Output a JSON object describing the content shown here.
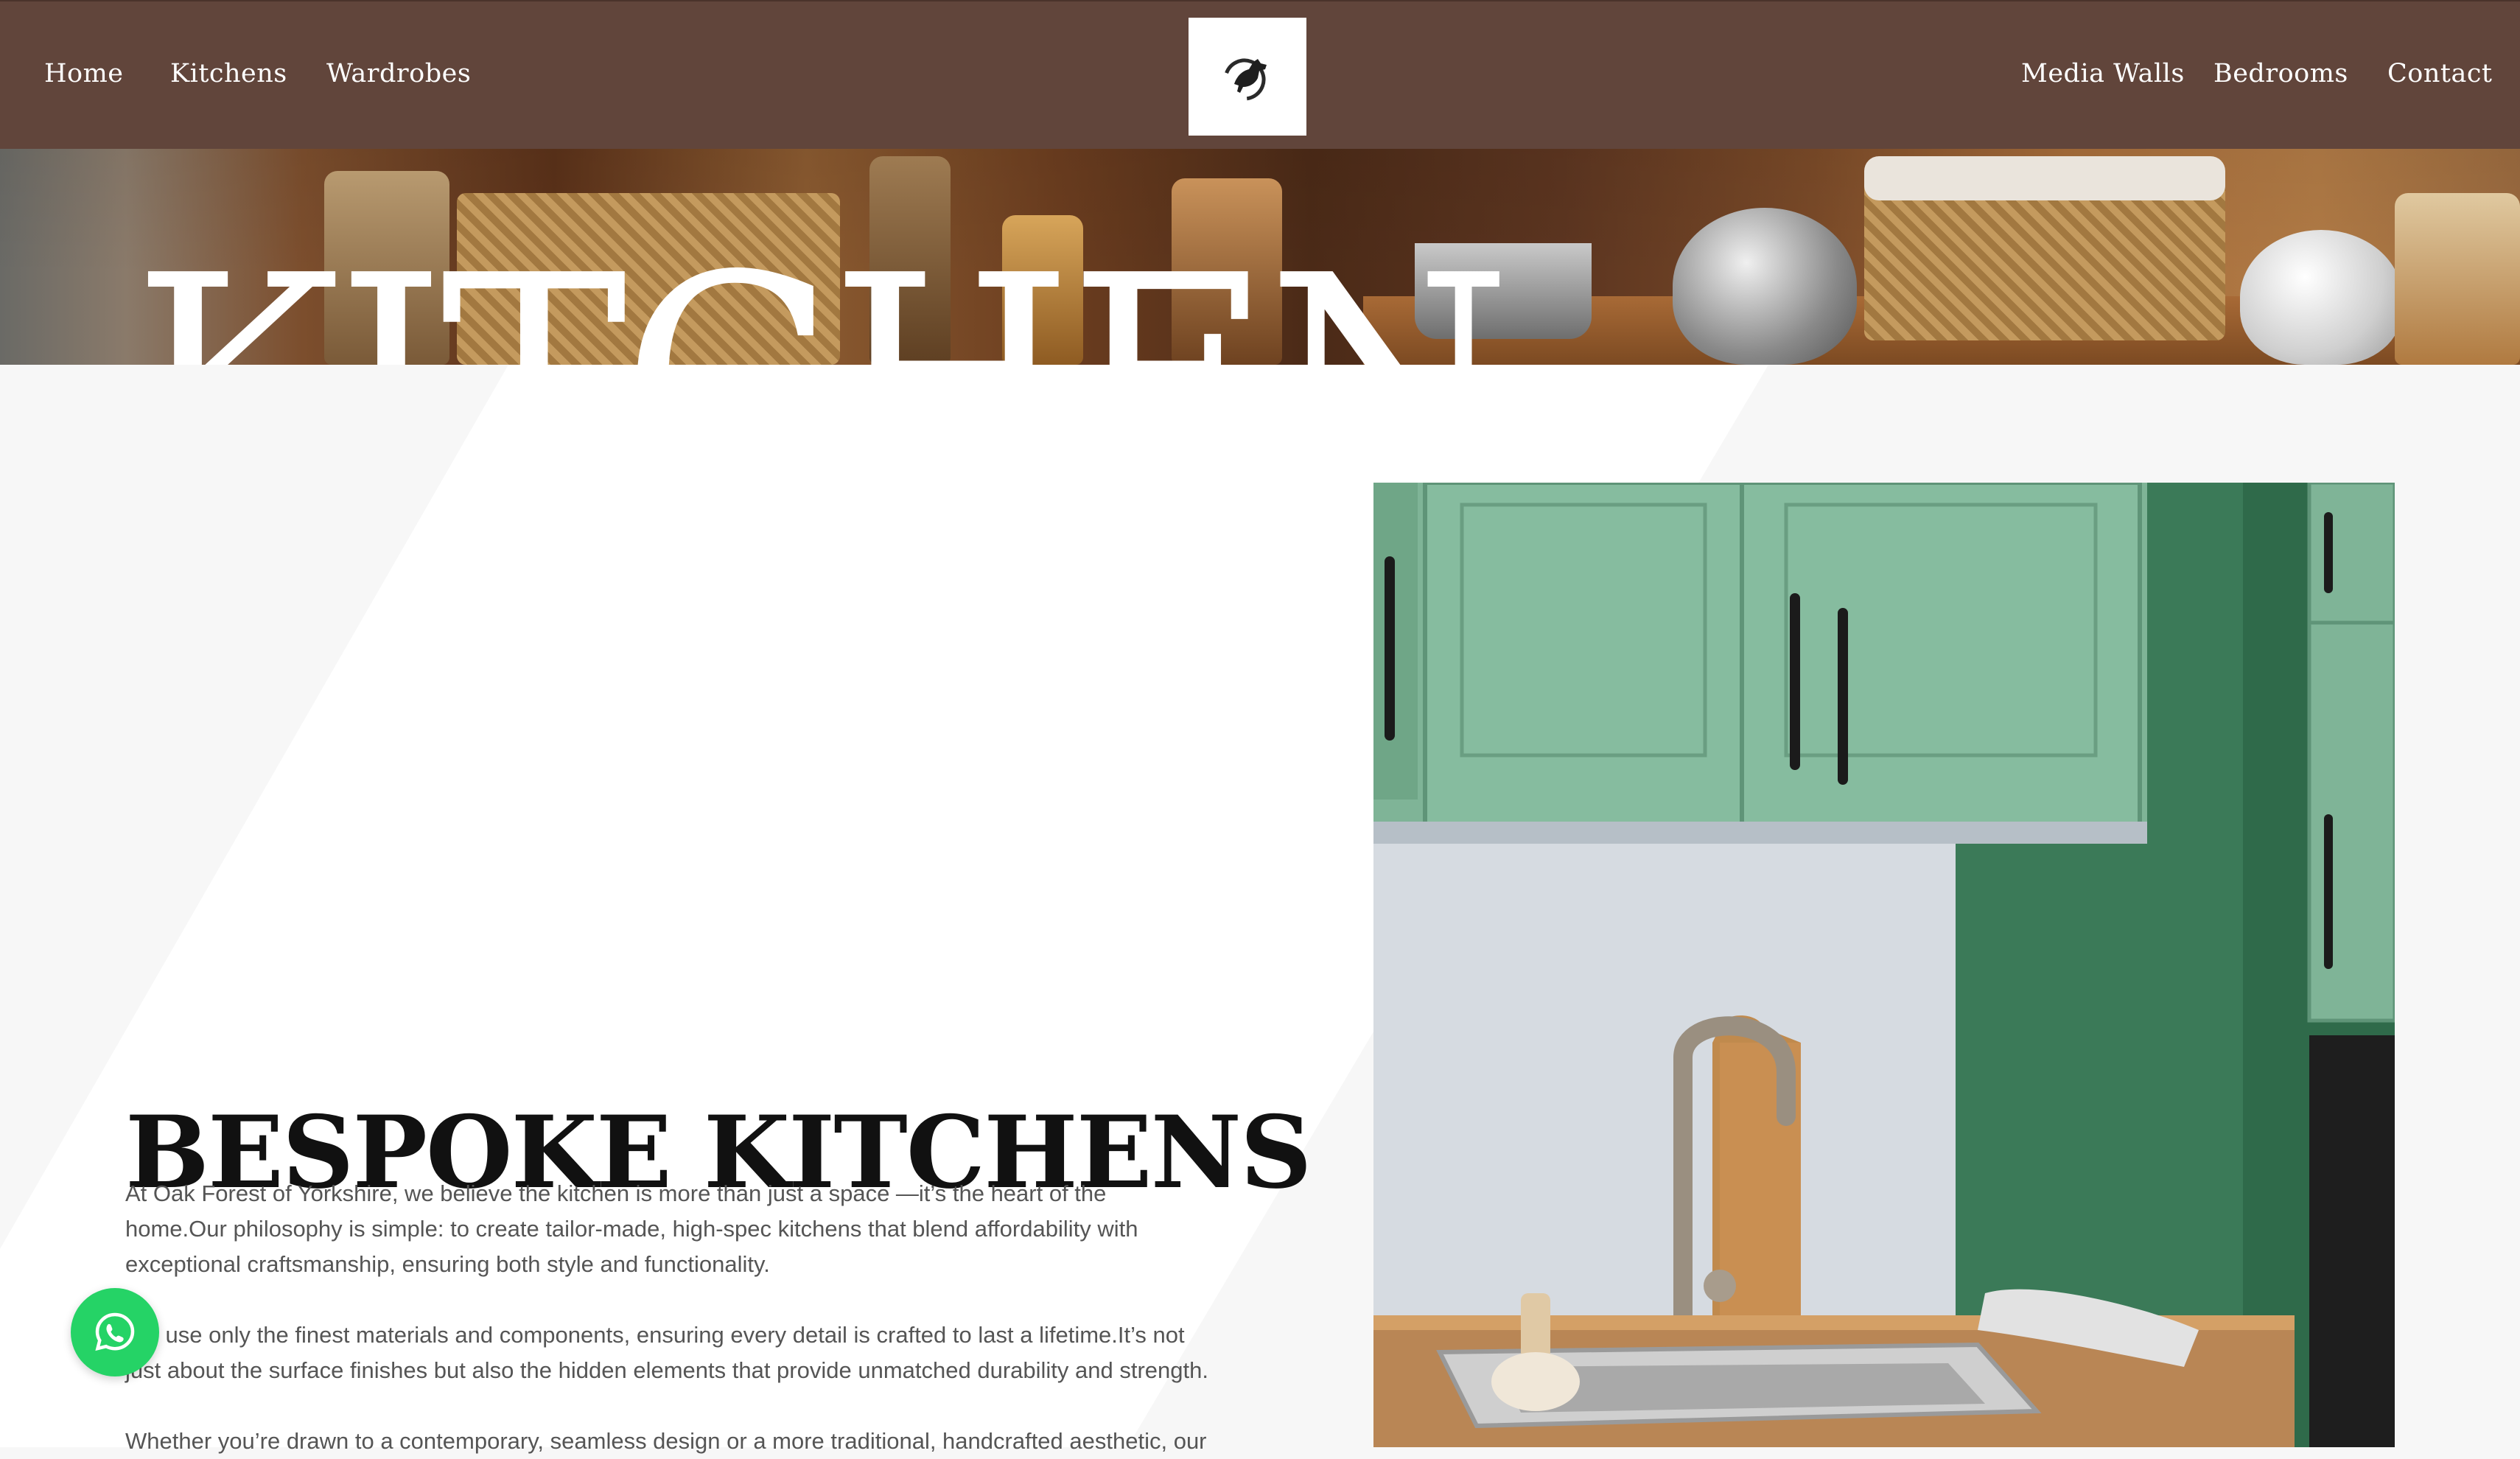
{
  "nav": {
    "left_items": [
      {
        "label": "Home"
      },
      {
        "label": "Kitchens"
      },
      {
        "label": "Wardrobes"
      }
    ],
    "right_items": [
      {
        "label": "Media Walls"
      },
      {
        "label": "Bedrooms"
      },
      {
        "label": "Contact"
      }
    ],
    "logo_icon": "horse-logo-icon"
  },
  "hero": {
    "title": "KITCHEN"
  },
  "main": {
    "heading": "BESPOKE KITCHENS",
    "paragraphs": [
      "At Oak Forest of Yorkshire, we believe the kitchen is more than just a space —it’s the heart of the home.Our philosophy is simple: to create tailor-made, high-spec kitchens that blend affordability with exceptional craftsmanship, ensuring both style and functionality.",
      "We use only the finest materials and components, ensuring every detail is crafted to last a lifetime.It’s not just about the surface finishes but also the hidden elements that provide unmatched durability and strength.",
      "Whether you’re drawn to a contemporary, seamless design or a more traditional, handcrafted aesthetic, our"
    ]
  },
  "widgets": {
    "whatsapp_icon": "whatsapp-icon"
  },
  "colors": {
    "nav_bg": "#61453b",
    "page_bg": "#f7f7f7",
    "whatsapp": "#25d366",
    "cabinet_green": "#7fb497"
  }
}
